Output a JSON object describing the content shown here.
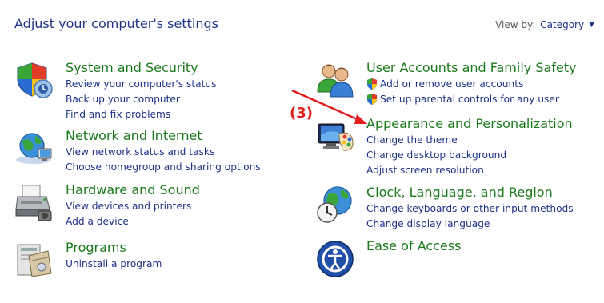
{
  "header": {
    "title": "Adjust your computer's settings",
    "view_by_label": "View by:",
    "view_by_value": "Category"
  },
  "annotation": {
    "label": "(3)",
    "color": "#e21b1b"
  },
  "categories": {
    "system_security": {
      "title": "System and Security",
      "icon": "shield-icon",
      "links": [
        "Review your computer's status",
        "Back up your computer",
        "Find and fix problems"
      ]
    },
    "network_internet": {
      "title": "Network and Internet",
      "icon": "network-globe-icon",
      "links": [
        "View network status and tasks",
        "Choose homegroup and sharing options"
      ]
    },
    "hardware_sound": {
      "title": "Hardware and Sound",
      "icon": "printer-icon",
      "links": [
        "View devices and printers",
        "Add a device"
      ]
    },
    "programs": {
      "title": "Programs",
      "icon": "programs-box-icon",
      "links": [
        "Uninstall a program"
      ]
    },
    "user_accounts": {
      "title": "User Accounts and Family Safety",
      "icon": "users-icon",
      "links": [
        "Add or remove user accounts",
        "Set up parental controls for any user"
      ]
    },
    "appearance": {
      "title": "Appearance and Personalization",
      "icon": "monitor-palette-icon",
      "links": [
        "Change the theme",
        "Change desktop background",
        "Adjust screen resolution"
      ]
    },
    "clock_language": {
      "title": "Clock, Language, and Region",
      "icon": "clock-globe-icon",
      "links": [
        "Change keyboards or other input methods",
        "Change display language"
      ]
    },
    "ease_access": {
      "title": "Ease of Access",
      "icon": "ease-of-access-icon",
      "links": []
    }
  },
  "colors": {
    "title_green": "#1a7a1a",
    "link_blue": "#1e3287",
    "arrow_red": "#e21b1b"
  }
}
